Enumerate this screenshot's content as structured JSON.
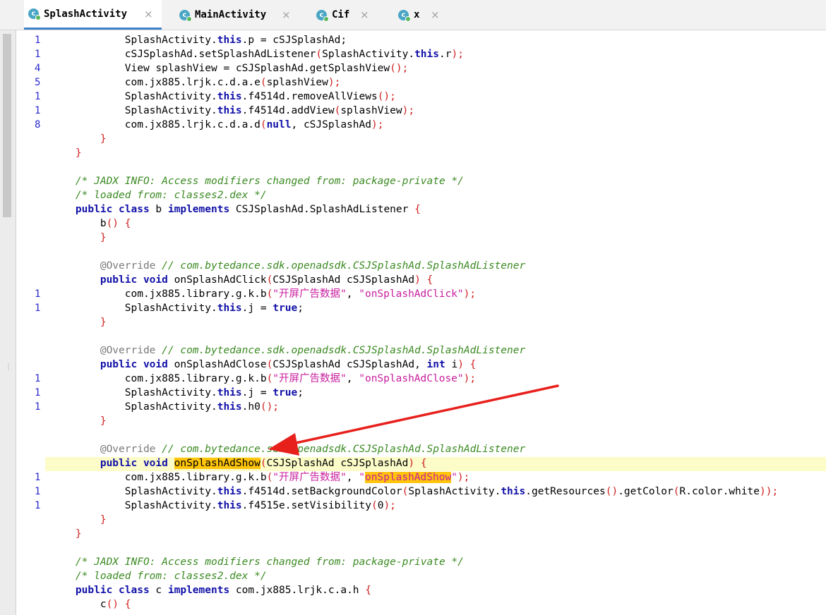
{
  "tabs": [
    {
      "label": "SplashActivity",
      "icon": "class-icon",
      "active": true
    },
    {
      "label": "MainActivity",
      "icon": "class-icon",
      "active": false
    },
    {
      "label": "Cif",
      "icon": "class-icon",
      "active": false
    },
    {
      "label": "x",
      "icon": "class-icon",
      "active": false
    }
  ],
  "tab_icon_glyph": "c",
  "close_glyph": "×",
  "gutter": [
    "1",
    "1",
    "4",
    "5",
    "1",
    "1",
    "8",
    "1",
    "1",
    "1",
    "1",
    "1",
    "1",
    "1",
    "1"
  ],
  "code": {
    "l1": {
      "a": "SplashActivity.",
      "b": "this",
      "c": ".p = cSJSplashAd;"
    },
    "l2": {
      "a": "cSJSplashAd.setSplashAdListener",
      "p1": "(",
      "b": "SplashActivity.",
      "c": "this",
      "d": ".r",
      "p2": ");"
    },
    "l3": {
      "a": "View splashView = cSJSplashAd.getSplashView",
      "p": "();"
    },
    "l4": {
      "a": "com.jx885.lrjk.c.d.a.e",
      "p1": "(",
      "b": "splashView",
      "p2": ");"
    },
    "l5": {
      "a": "SplashActivity.",
      "b": "this",
      "c": ".f4514d.removeAllViews",
      "p": "();"
    },
    "l6": {
      "a": "SplashActivity.",
      "b": "this",
      "c": ".f4514d.addView",
      "p1": "(",
      "d": "splashView",
      "p2": ");"
    },
    "l7": {
      "a": "com.jx885.lrjk.c.d.a.d",
      "p1": "(",
      "b": "null",
      "c": ", cSJSplashAd",
      "p2": ");"
    },
    "brace_close": "}",
    "brace_open": "{",
    "comment1": "/* JADX INFO: Access modifiers changed from: package-private */",
    "comment2": "/* loaded from: classes2.dex */",
    "class_b": {
      "kw1": "public class",
      "name": " b ",
      "kw2": "implements",
      "rest": " CSJSplashAd.SplashAdListener "
    },
    "ctor_b": {
      "name": "b",
      "parens": "()"
    },
    "override": "@Override",
    "iface_comment": "// com.bytedance.sdk.openadsdk.CSJSplashAd.SplashAdListener",
    "public_void": "public void",
    "m_click": {
      "name": " onSplashAdClick",
      "args": "CSJSplashAd cSJSplashAd",
      "p1": "(",
      "p2": ") {"
    },
    "log_prefix": "com.jx885.library.g.k.b",
    "log_tag": "\"开屏广告数据\"",
    "comma": ", ",
    "str_click": "\"onSplashAdClick\"",
    "close_call": ");",
    "set_j_a": "SplashActivity.",
    "kw_this": "this",
    "set_j_b": ".j = ",
    "kw_true": "true",
    "semicolon": ";",
    "m_close": {
      "name": " onSplashAdClose",
      "args": "CSJSplashAd cSJSplashAd, ",
      "kw_int": "int",
      "arg2": " i",
      "p1": "(",
      "p2": ") {"
    },
    "str_close": "\"onSplashAdClose\"",
    "h0_b": ".h0",
    "paren_pair_semi": "();",
    "m_show": {
      "name": "onSplashAdShow",
      "args": "CSJSplashAd cSJSplashAd",
      "p1": "(",
      "p2": ") {"
    },
    "str_show": {
      "q1": "\"",
      "v": "onSplashAdShow",
      "q2": "\""
    },
    "setbg": {
      "a": ".f4514d.setBackgroundColor",
      "p1": "(",
      "b": "SplashActivity.",
      "c": ".getResources",
      "p2": "()",
      "d": ".getColor",
      "p3": "(",
      "e": "R.color.white",
      "p4": "));"
    },
    "setvis": {
      "a": ".f4515e.setVisibility",
      "p1": "(",
      "n": "0",
      "p2": ");"
    },
    "class_c": {
      "kw1": "public class",
      "name": " c ",
      "kw2": "implements",
      "rest": " com.jx885.lrjk.c.a.h "
    },
    "ctor_c": {
      "name": "c",
      "parens": "()"
    }
  },
  "colors": {
    "keyword": "#1111a8",
    "comment": "#3b8a22",
    "string": "#c81e9e",
    "paren": "#d02020",
    "highlight": "#ffc40c",
    "current_line": "#fcfcc8",
    "arrow": "#e8201c"
  }
}
